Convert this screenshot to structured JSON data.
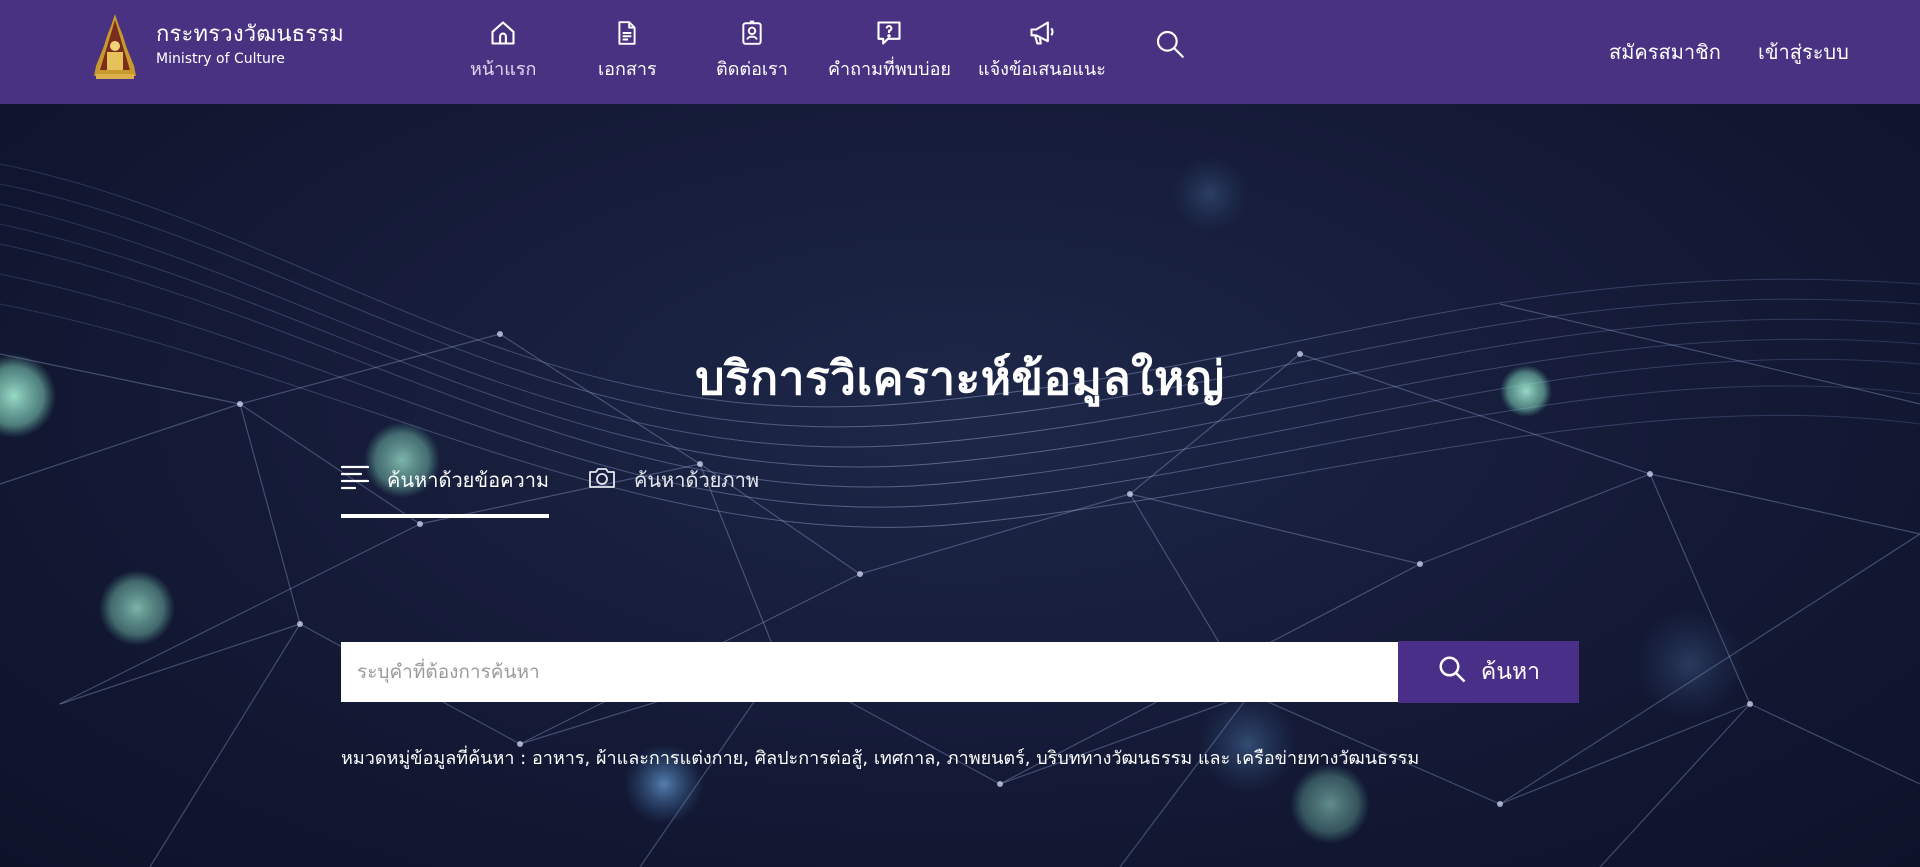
{
  "header": {
    "brand_th": "กระทรวงวัฒนธรรม",
    "brand_en": "Ministry of Culture",
    "nav": [
      {
        "label": "หน้าแรก",
        "icon": "home-icon"
      },
      {
        "label": "เอกสาร",
        "icon": "document-icon"
      },
      {
        "label": "ติดต่อเรา",
        "icon": "contact-card-icon"
      },
      {
        "label": "คำถามที่พบบ่อย",
        "icon": "faq-icon"
      },
      {
        "label": "แจ้งข้อเสนอแนะ",
        "icon": "megaphone-icon"
      }
    ],
    "search_icon": "search-icon",
    "register_label": "สมัครสมาชิก",
    "login_label": "เข้าสู่ระบบ"
  },
  "hero": {
    "title": "บริการวิเคราะห์ข้อมูลใหญ่",
    "tabs": [
      {
        "label": "ค้นหาด้วยข้อความ",
        "icon": "text-lines-icon",
        "active": true
      },
      {
        "label": "ค้นหาด้วยภาพ",
        "icon": "camera-icon",
        "active": false
      }
    ],
    "search": {
      "placeholder": "ระบุคำที่ต้องการค้นหา",
      "value": "",
      "button_label": "ค้นหา"
    },
    "categories_text": "หมวดหมู่ข้อมูลที่ค้นหา : อาหาร, ผ้าและการแต่งกาย, ศิลปะการต่อสู้, เทศกาล, ภาพยนตร์, บริบททางวัฒนธรรม และ เครือข่ายทางวัฒนธรรม"
  },
  "colors": {
    "header_bg": "#4a3283",
    "button_bg": "#4a2f88",
    "hero_bg": "#141a36",
    "accent_glow": "#8fd9c2"
  }
}
